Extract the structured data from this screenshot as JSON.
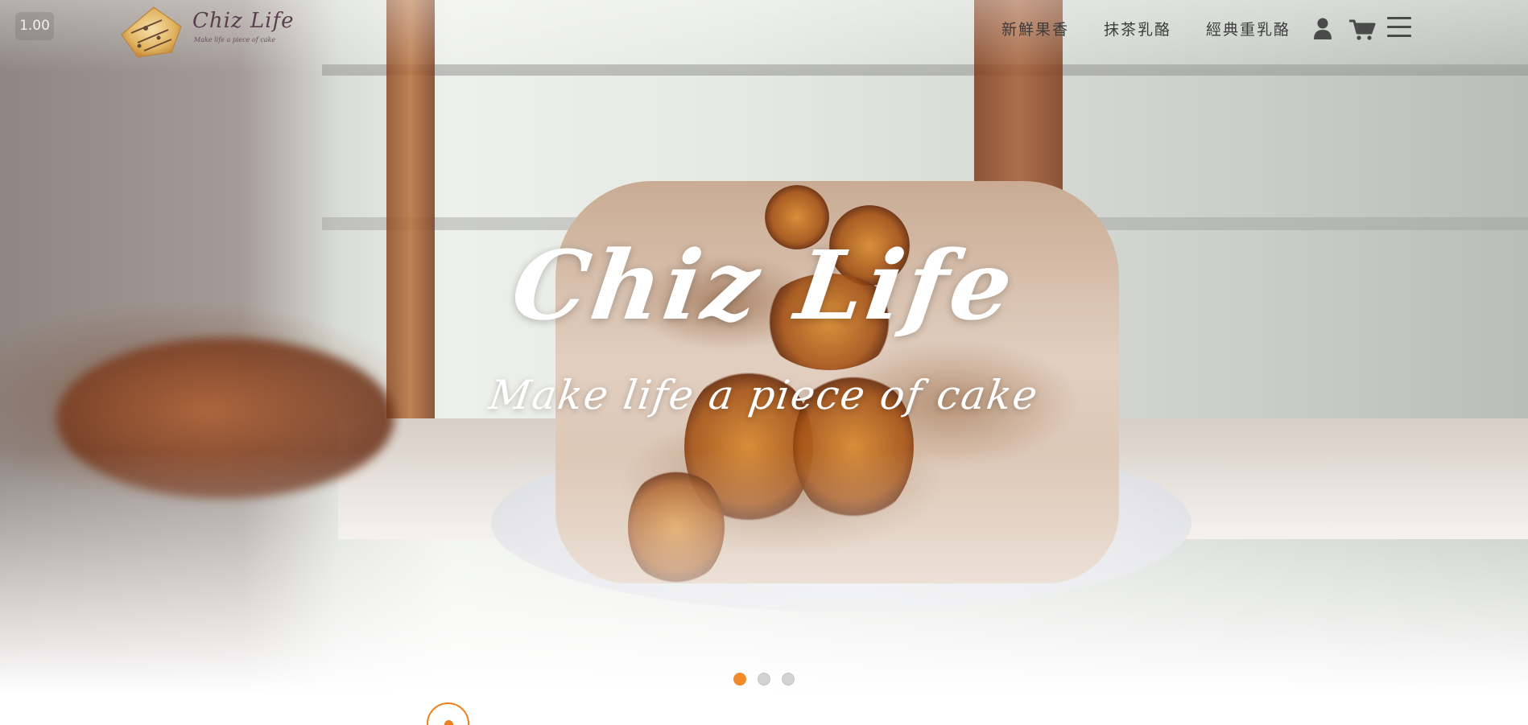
{
  "zoom": {
    "label": "1.00"
  },
  "brand": {
    "name": "Chiz Life",
    "tagline_small": "Make life a piece of cake"
  },
  "nav": {
    "items": [
      {
        "label": "新鮮果香"
      },
      {
        "label": "抹茶乳酪"
      },
      {
        "label": "經典重乳酪"
      }
    ],
    "icons": [
      "user-icon",
      "cart-icon",
      "menu-icon"
    ]
  },
  "hero": {
    "title": "Chiz Life",
    "tagline": "Make life a piece of cake"
  },
  "carousel": {
    "slides": 3,
    "active": 1
  },
  "colors": {
    "accent": "#f28a2a",
    "nav_text": "#3d3d3d",
    "logo": "#5a3f4f",
    "hero_text": "#ffffff"
  }
}
